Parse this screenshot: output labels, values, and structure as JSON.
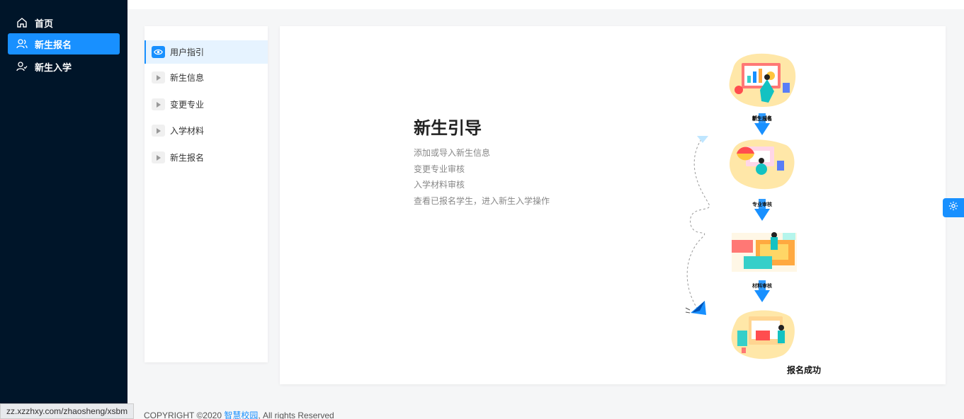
{
  "sidebar": {
    "items": [
      {
        "label": "首页",
        "icon": "home-icon"
      },
      {
        "label": "新生报名",
        "icon": "users-icon",
        "active": true
      },
      {
        "label": "新生入学",
        "icon": "user-check-icon"
      }
    ]
  },
  "steps": [
    {
      "label": "用户指引",
      "icon": "eye-icon",
      "active": true
    },
    {
      "label": "新生信息",
      "icon": "play-icon"
    },
    {
      "label": "变更专业",
      "icon": "play-icon"
    },
    {
      "label": "入学材料",
      "icon": "play-icon"
    },
    {
      "label": "新生报名",
      "icon": "play-icon"
    }
  ],
  "guide": {
    "title": "新生引导",
    "lines": [
      "添加或导入新生信息",
      "变更专业审核",
      "入学材料审核",
      "查看已报名学生，进入新生入学操作"
    ]
  },
  "flow": {
    "labels": [
      "新生报名",
      "专业审核",
      "材料审核"
    ],
    "final": "报名成功"
  },
  "footer": {
    "url": "zz.xzzhxy.com/zhaosheng/xsbm",
    "copyright_prefix": "COPYRIGHT ©2020 ",
    "copyright_link": "智慧校园",
    "copyright_suffix": ", All rights Reserved"
  },
  "colors": {
    "accent": "#1890ff",
    "sidebar": "#001529"
  }
}
